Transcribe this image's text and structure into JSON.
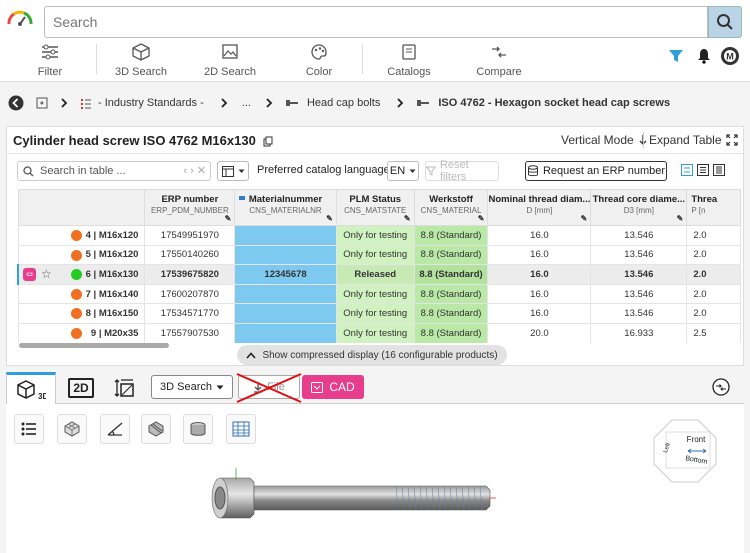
{
  "search": {
    "placeholder": "Search"
  },
  "toolbar": [
    {
      "label": "Filter",
      "icon": "filter-sliders-icon"
    },
    {
      "label": "3D Search",
      "icon": "cube-icon"
    },
    {
      "label": "2D Search",
      "icon": "image-icon"
    },
    {
      "label": "Color",
      "icon": "palette-icon"
    },
    {
      "label": "Catalogs",
      "icon": "catalog-icon"
    },
    {
      "label": "Compare",
      "icon": "compare-arrows-icon"
    }
  ],
  "breadcrumb": [
    "- Industry Standards -",
    "...",
    "Head cap bolts",
    "ISO 4762 - Hexagon socket head cap screws"
  ],
  "panel": {
    "title": "Cylinder head screw ISO 4762 M16x130",
    "vertical_mode": "Vertical Mode",
    "expand_table": "Expand Table"
  },
  "filterbar": {
    "search_placeholder": "Search in table ...",
    "language_label": "Preferred catalog language",
    "language_value": "EN",
    "reset_filters": "Reset filters",
    "request_erp": "Request an ERP number"
  },
  "table": {
    "columns": [
      {
        "title": "ERP number",
        "sub": "ERP_PDM_NUMBER"
      },
      {
        "title": "Materialnummer",
        "sub": "CNS_MATERIALNR"
      },
      {
        "title": "PLM Status",
        "sub": "CNS_MATSTATE"
      },
      {
        "title": "Werkstoff",
        "sub": "CNS_MATERIAL"
      },
      {
        "title": "Nominal thread diam...",
        "sub": "D [mm]"
      },
      {
        "title": "Thread core diame...",
        "sub": "D3 [mm]"
      },
      {
        "title": "Threa",
        "sub": "P [n"
      }
    ],
    "rows": [
      {
        "label": "4 | M16x120",
        "erp": "17549951970",
        "mat": "",
        "plm": "Only for testing",
        "werk": "8.8 (Standard)",
        "d": "16.0",
        "d3": "13.546",
        "p": "2.0"
      },
      {
        "label": "5 | M16x120",
        "erp": "17550140260",
        "mat": "",
        "plm": "Only for testing",
        "werk": "8.8 (Standard)",
        "d": "16.0",
        "d3": "13.546",
        "p": "2.0"
      },
      {
        "label": "6 | M16x130",
        "erp": "17539675820",
        "mat": "12345678",
        "plm": "Released",
        "werk": "8.8 (Standard)",
        "d": "16.0",
        "d3": "13.546",
        "p": "2.0"
      },
      {
        "label": "7 | M16x140",
        "erp": "17600207870",
        "mat": "",
        "plm": "Only for testing",
        "werk": "8.8 (Standard)",
        "d": "16.0",
        "d3": "13.546",
        "p": "2.0"
      },
      {
        "label": "8 | M16x150",
        "erp": "17534571770",
        "mat": "",
        "plm": "Only for testing",
        "werk": "8.8 (Standard)",
        "d": "16.0",
        "d3": "13.546",
        "p": "2.0"
      },
      {
        "label": "9 | M20x35",
        "erp": "17557907530",
        "mat": "",
        "plm": "Only for testing",
        "werk": "8.8 (Standard)",
        "d": "20.0",
        "d3": "16.933",
        "p": "2.5"
      }
    ],
    "compressed": "Show compressed display (16 configurable products)"
  },
  "tabs": {
    "tab3d": "3D",
    "tab2d": "2D",
    "search3d": "3D Search",
    "file": "File",
    "cad": "CAD"
  },
  "viewcube": {
    "front": "Front",
    "bottom": "Bottom",
    "left": "Left"
  },
  "colors": {
    "accent": "#2d9fd9",
    "cad": "#e83c8c",
    "released": "#22cc22",
    "testing": "#f07020"
  }
}
